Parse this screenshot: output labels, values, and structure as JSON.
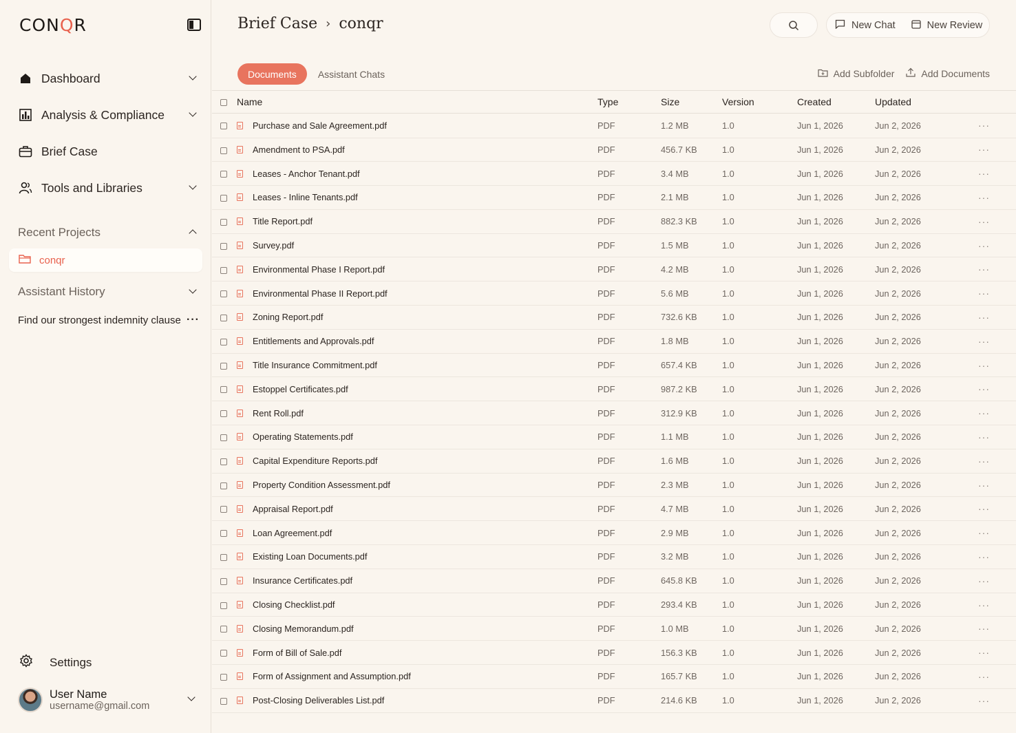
{
  "app": {
    "logo_text": "CON",
    "logo_accent": "Q",
    "logo_text_end": "R"
  },
  "sidebar": {
    "nav": [
      {
        "label": "Dashboard",
        "icon": "home-icon"
      },
      {
        "label": "Analysis & Compliance",
        "icon": "bar-chart-icon"
      },
      {
        "label": "Brief Case",
        "icon": "briefcase-icon"
      },
      {
        "label": "Tools and Libraries",
        "icon": "users-icon"
      }
    ],
    "recent_projects_label": "Recent Projects",
    "recent_projects": [
      {
        "label": "conqr"
      }
    ],
    "assistant_history_label": "Assistant History",
    "assistant_history": [
      {
        "label": "Find our strongest indemnity clause"
      }
    ],
    "settings_label": "Settings",
    "user": {
      "name": "User Name",
      "email": "username@gmail.com"
    }
  },
  "header": {
    "breadcrumb": [
      "Brief Case",
      "conqr"
    ],
    "new_chat_label": "New Chat",
    "new_review_label": "New Review"
  },
  "tabs": {
    "active": "Documents",
    "other": "Assistant Chats"
  },
  "toolbar": {
    "add_subfolder_label": "Add Subfolder",
    "add_documents_label": "Add Documents"
  },
  "table": {
    "columns": [
      "Name",
      "Type",
      "Size",
      "Version",
      "Created",
      "Updated"
    ],
    "rows": [
      {
        "name": "Purchase and Sale Agreement.pdf",
        "type": "PDF",
        "size": "1.2 MB",
        "version": "1.0",
        "created": "Jun 1, 2026",
        "updated": "Jun 2, 2026"
      },
      {
        "name": "Amendment to PSA.pdf",
        "type": "PDF",
        "size": "456.7 KB",
        "version": "1.0",
        "created": "Jun 1, 2026",
        "updated": "Jun 2, 2026"
      },
      {
        "name": "Leases - Anchor Tenant.pdf",
        "type": "PDF",
        "size": "3.4 MB",
        "version": "1.0",
        "created": "Jun 1, 2026",
        "updated": "Jun 2, 2026"
      },
      {
        "name": "Leases - Inline Tenants.pdf",
        "type": "PDF",
        "size": "2.1 MB",
        "version": "1.0",
        "created": "Jun 1, 2026",
        "updated": "Jun 2, 2026"
      },
      {
        "name": "Title Report.pdf",
        "type": "PDF",
        "size": "882.3 KB",
        "version": "1.0",
        "created": "Jun 1, 2026",
        "updated": "Jun 2, 2026"
      },
      {
        "name": "Survey.pdf",
        "type": "PDF",
        "size": "1.5 MB",
        "version": "1.0",
        "created": "Jun 1, 2026",
        "updated": "Jun 2, 2026"
      },
      {
        "name": "Environmental Phase I Report.pdf",
        "type": "PDF",
        "size": "4.2 MB",
        "version": "1.0",
        "created": "Jun 1, 2026",
        "updated": "Jun 2, 2026"
      },
      {
        "name": "Environmental Phase II Report.pdf",
        "type": "PDF",
        "size": "5.6 MB",
        "version": "1.0",
        "created": "Jun 1, 2026",
        "updated": "Jun 2, 2026"
      },
      {
        "name": "Zoning Report.pdf",
        "type": "PDF",
        "size": "732.6 KB",
        "version": "1.0",
        "created": "Jun 1, 2026",
        "updated": "Jun 2, 2026"
      },
      {
        "name": "Entitlements and Approvals.pdf",
        "type": "PDF",
        "size": "1.8 MB",
        "version": "1.0",
        "created": "Jun 1, 2026",
        "updated": "Jun 2, 2026"
      },
      {
        "name": "Title Insurance Commitment.pdf",
        "type": "PDF",
        "size": "657.4 KB",
        "version": "1.0",
        "created": "Jun 1, 2026",
        "updated": "Jun 2, 2026"
      },
      {
        "name": "Estoppel Certificates.pdf",
        "type": "PDF",
        "size": "987.2 KB",
        "version": "1.0",
        "created": "Jun 1, 2026",
        "updated": "Jun 2, 2026"
      },
      {
        "name": "Rent Roll.pdf",
        "type": "PDF",
        "size": "312.9 KB",
        "version": "1.0",
        "created": "Jun 1, 2026",
        "updated": "Jun 2, 2026"
      },
      {
        "name": "Operating Statements.pdf",
        "type": "PDF",
        "size": "1.1 MB",
        "version": "1.0",
        "created": "Jun 1, 2026",
        "updated": "Jun 2, 2026"
      },
      {
        "name": "Capital Expenditure Reports.pdf",
        "type": "PDF",
        "size": "1.6 MB",
        "version": "1.0",
        "created": "Jun 1, 2026",
        "updated": "Jun 2, 2026"
      },
      {
        "name": "Property Condition Assessment.pdf",
        "type": "PDF",
        "size": "2.3 MB",
        "version": "1.0",
        "created": "Jun 1, 2026",
        "updated": "Jun 2, 2026"
      },
      {
        "name": "Appraisal Report.pdf",
        "type": "PDF",
        "size": "4.7 MB",
        "version": "1.0",
        "created": "Jun 1, 2026",
        "updated": "Jun 2, 2026"
      },
      {
        "name": "Loan Agreement.pdf",
        "type": "PDF",
        "size": "2.9 MB",
        "version": "1.0",
        "created": "Jun 1, 2026",
        "updated": "Jun 2, 2026"
      },
      {
        "name": "Existing Loan Documents.pdf",
        "type": "PDF",
        "size": "3.2 MB",
        "version": "1.0",
        "created": "Jun 1, 2026",
        "updated": "Jun 2, 2026"
      },
      {
        "name": "Insurance Certificates.pdf",
        "type": "PDF",
        "size": "645.8 KB",
        "version": "1.0",
        "created": "Jun 1, 2026",
        "updated": "Jun 2, 2026"
      },
      {
        "name": "Closing Checklist.pdf",
        "type": "PDF",
        "size": "293.4 KB",
        "version": "1.0",
        "created": "Jun 1, 2026",
        "updated": "Jun 2, 2026"
      },
      {
        "name": "Closing Memorandum.pdf",
        "type": "PDF",
        "size": "1.0 MB",
        "version": "1.0",
        "created": "Jun 1, 2026",
        "updated": "Jun 2, 2026"
      },
      {
        "name": "Form of Bill of Sale.pdf",
        "type": "PDF",
        "size": "156.3 KB",
        "version": "1.0",
        "created": "Jun 1, 2026",
        "updated": "Jun 2, 2026"
      },
      {
        "name": "Form of Assignment and Assumption.pdf",
        "type": "PDF",
        "size": "165.7 KB",
        "version": "1.0",
        "created": "Jun 1, 2026",
        "updated": "Jun 2, 2026"
      },
      {
        "name": "Post-Closing Deliverables List.pdf",
        "type": "PDF",
        "size": "214.6 KB",
        "version": "1.0",
        "created": "Jun 1, 2026",
        "updated": "Jun 2, 2026"
      }
    ]
  },
  "colors": {
    "accent": "#e8745e",
    "background": "#faf5ee",
    "text": "#2b2420",
    "muted": "#6e6660"
  }
}
